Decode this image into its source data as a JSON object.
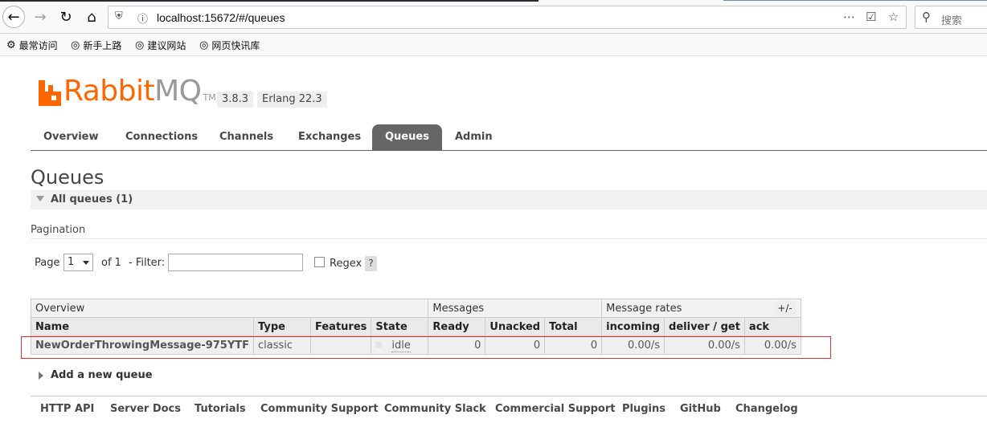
{
  "browser": {
    "url": "localhost:15672/#/queues",
    "search_placeholder": "搜索",
    "icons": [
      "back-icon",
      "forward-icon",
      "reload-icon",
      "home-icon",
      "shield-icon",
      "info-icon",
      "more-icon",
      "pocket-icon",
      "star-icon",
      "search-icon"
    ],
    "bookmarks": [
      {
        "label": "最常访问",
        "icon": "gear-icon"
      },
      {
        "label": "新手上路",
        "icon": "globe-icon"
      },
      {
        "label": "建议网站",
        "icon": "globe-icon"
      },
      {
        "label": "网页快讯库",
        "icon": "globe-icon"
      }
    ]
  },
  "header": {
    "logo_rabbit": "Rabbit",
    "logo_mq": "MQ",
    "logo_tm": "TM",
    "version": "3.8.3",
    "erlang": "Erlang 22.3"
  },
  "tabs": [
    {
      "label": "Overview",
      "active": false
    },
    {
      "label": "Connections",
      "active": false
    },
    {
      "label": "Channels",
      "active": false
    },
    {
      "label": "Exchanges",
      "active": false
    },
    {
      "label": "Queues",
      "active": true
    },
    {
      "label": "Admin",
      "active": false
    }
  ],
  "page": {
    "title": "Queues",
    "section": "All queues (1)",
    "pagination_label": "Pagination",
    "page_label": "Page",
    "page_value": "1",
    "of_label": "of 1",
    "filter_label": "- Filter:",
    "filter_value": "",
    "regex_label": "Regex",
    "help_label": "?",
    "plus_minus": "+/-",
    "add_queue": "Add a new queue"
  },
  "table": {
    "groups": [
      "Overview",
      "Messages",
      "Message rates"
    ],
    "columns": [
      "Name",
      "Type",
      "Features",
      "State",
      "Ready",
      "Unacked",
      "Total",
      "incoming",
      "deliver / get",
      "ack"
    ],
    "rows": [
      {
        "name": "NewOrderThrowingMessage-975YTF",
        "type": "classic",
        "features": "",
        "state": "idle",
        "ready": "0",
        "unacked": "0",
        "total": "0",
        "incoming": "0.00/s",
        "deliver_get": "0.00/s",
        "ack": "0.00/s"
      }
    ]
  },
  "footer": [
    "HTTP API",
    "Server Docs",
    "Tutorials",
    "Community Support",
    "Community Slack",
    "Commercial Support",
    "Plugins",
    "GitHub",
    "Changelog"
  ],
  "colors": {
    "brand": "#ff6600",
    "highlight": "#e03030",
    "active_tab": "#666666"
  }
}
